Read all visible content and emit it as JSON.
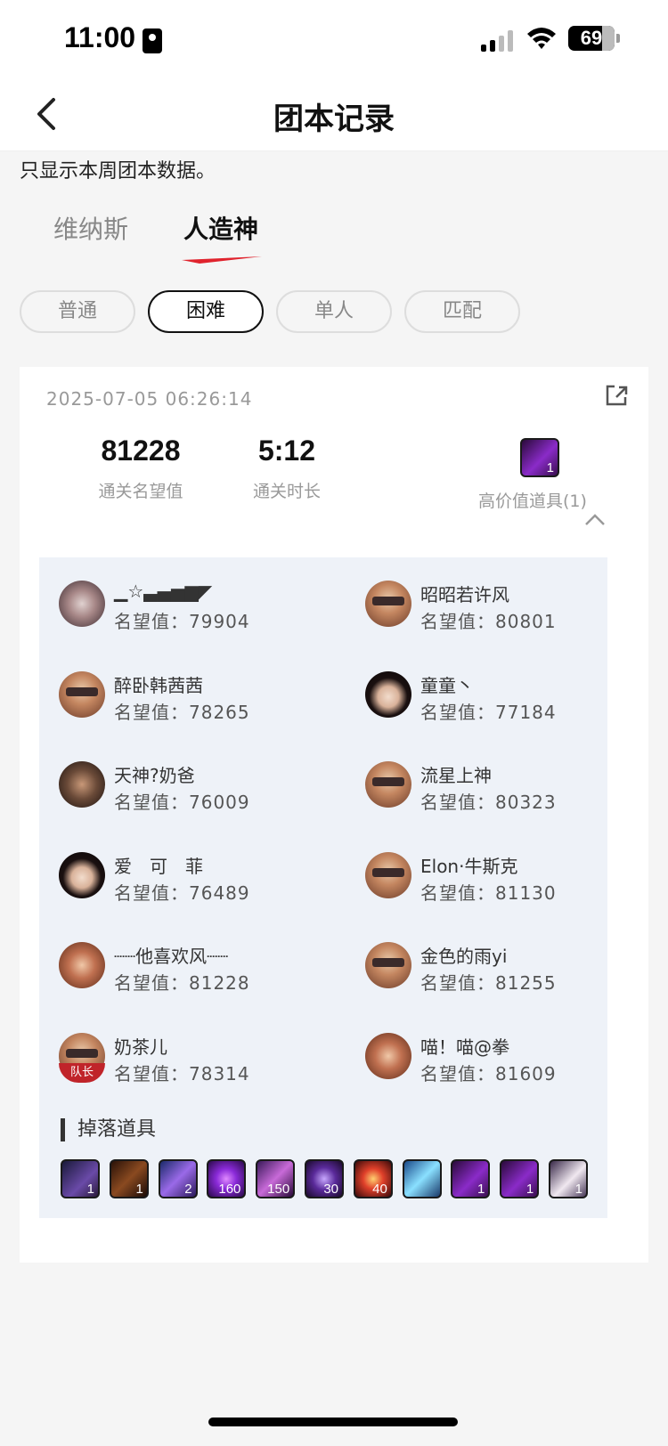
{
  "status_bar": {
    "time": "11:00",
    "battery": "69"
  },
  "header": {
    "title": "团本记录"
  },
  "notice": "只显示本周团本数据。",
  "tabs": [
    {
      "label": "维纳斯",
      "active": false
    },
    {
      "label": "人造神",
      "active": true
    }
  ],
  "filters": [
    {
      "label": "普通",
      "selected": false
    },
    {
      "label": "困难",
      "selected": true
    },
    {
      "label": "单人",
      "selected": false
    },
    {
      "label": "匹配",
      "selected": false
    }
  ],
  "record": {
    "datetime": "2025-07-05 06:26:14",
    "clear_reputation": "81228",
    "clear_reputation_label": "通关名望值",
    "clear_time": "5:12",
    "clear_time_label": "通关时长",
    "high_value_item_count": "1",
    "high_value_label": "高价值道具(1)"
  },
  "rep_prefix": "名望值：",
  "members": [
    {
      "name": "▁☆▃▄▅▆◤",
      "reputation": "79904",
      "avatar": "silver",
      "leader": false
    },
    {
      "name": "昭昭若许风",
      "reputation": "80801",
      "avatar": "berserker",
      "leader": false
    },
    {
      "name": "醉卧韩茜茜",
      "reputation": "78265",
      "avatar": "berserker",
      "leader": false
    },
    {
      "name": "童童丶",
      "reputation": "77184",
      "avatar": "dark-hair",
      "leader": false
    },
    {
      "name": "天神?奶爸",
      "reputation": "76009",
      "avatar": "male",
      "leader": false
    },
    {
      "name": "流星上神",
      "reputation": "80323",
      "avatar": "berserker",
      "leader": false
    },
    {
      "name": "爱　可　菲",
      "reputation": "76489",
      "avatar": "dark-hair",
      "leader": false
    },
    {
      "name": "Elon·牛斯克",
      "reputation": "81130",
      "avatar": "berserker",
      "leader": false
    },
    {
      "name": "┈┈他喜欢风┈┈",
      "reputation": "81228",
      "avatar": "brown",
      "leader": false
    },
    {
      "name": "金色的雨yi",
      "reputation": "81255",
      "avatar": "berserker",
      "leader": false
    },
    {
      "name": "奶茶儿",
      "reputation": "78314",
      "avatar": "berserker",
      "leader": true,
      "leader_label": "队长"
    },
    {
      "name": "喵！喵@拳",
      "reputation": "81609",
      "avatar": "brown",
      "leader": false
    }
  ],
  "drops": {
    "title": "掉落道具",
    "items": [
      {
        "count": "1"
      },
      {
        "count": "1"
      },
      {
        "count": "2"
      },
      {
        "count": "160"
      },
      {
        "count": "150"
      },
      {
        "count": "30"
      },
      {
        "count": "40"
      },
      {
        "count": ""
      },
      {
        "count": "1"
      },
      {
        "count": "1"
      },
      {
        "count": "1"
      }
    ]
  }
}
